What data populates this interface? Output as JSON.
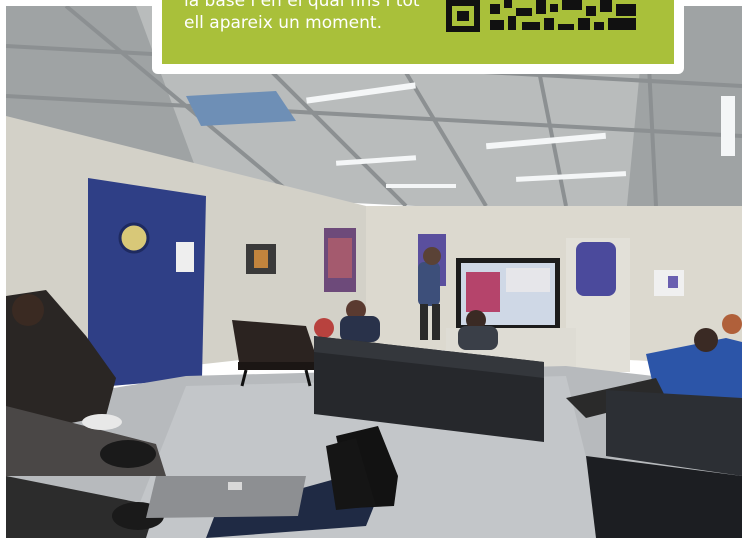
{
  "caption": {
    "line1": "la base i en el qual fins i tot",
    "line2": "ell apareix un moment.",
    "background_color": "#a9c03a"
  },
  "qr_code": {
    "icon": "qr-code-icon"
  },
  "photo": {
    "subject": "",
    "screen_colors": [
      "#cfd8e6",
      "#b5446b"
    ]
  }
}
